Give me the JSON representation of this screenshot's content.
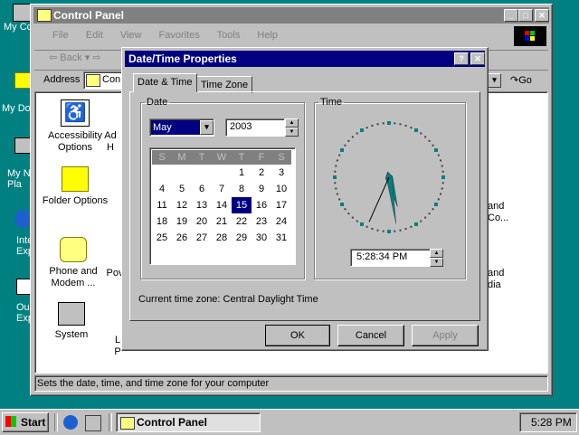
{
  "desktop": {
    "icons": [
      {
        "label": "My Co",
        "name": "desktop-icon-my-computer"
      },
      {
        "label": "My Do",
        "name": "desktop-icon-my-documents"
      },
      {
        "label": "My N\nPla",
        "name": "desktop-icon-network"
      },
      {
        "label": "Inte\nExp",
        "name": "desktop-icon-internet-explorer"
      },
      {
        "label": "Ou\nExp",
        "name": "desktop-icon-outlook-express"
      }
    ]
  },
  "control_panel": {
    "title": "Control Panel",
    "menu": [
      "File",
      "Edit",
      "View",
      "Favorites",
      "Tools",
      "Help"
    ],
    "back_label": "Back",
    "address_label": "Address",
    "address_value": "Con",
    "go_label": "Go",
    "status": "Sets the date, time, and time zone for your computer",
    "items": [
      {
        "label": "Accessibility\nOptions"
      },
      {
        "label": "Ad\nH"
      },
      {
        "label": "Folder Options"
      },
      {
        "label": "Phone and\nModem ..."
      },
      {
        "label": "Pov"
      },
      {
        "label": "System"
      },
      {
        "label": "L\nP"
      },
      {
        "label": "and\nCo..."
      },
      {
        "label": "and\ndia"
      }
    ]
  },
  "dialog": {
    "title": "Date/Time Properties",
    "help_label": "?",
    "close_label": "✕",
    "tabs": [
      "Date & Time",
      "Time Zone"
    ],
    "date_group": "Date",
    "time_group": "Time",
    "month": "May",
    "year": "2003",
    "weekdays": [
      "S",
      "M",
      "T",
      "W",
      "T",
      "F",
      "S"
    ],
    "weeks": [
      [
        "",
        "",
        "",
        "",
        "1",
        "2",
        "3"
      ],
      [
        "4",
        "5",
        "6",
        "7",
        "8",
        "9",
        "10"
      ],
      [
        "11",
        "12",
        "13",
        "14",
        "15",
        "16",
        "17"
      ],
      [
        "18",
        "19",
        "20",
        "21",
        "22",
        "23",
        "24"
      ],
      [
        "25",
        "26",
        "27",
        "28",
        "29",
        "30",
        "31"
      ]
    ],
    "selected_day": "15",
    "time_value": "5:28:34 PM",
    "time_zone_text": "Current time zone:  Central Daylight Time",
    "ok_label": "OK",
    "cancel_label": "Cancel",
    "apply_label": "Apply"
  },
  "taskbar": {
    "start_label": "Start",
    "task_label": "Control Panel",
    "clock": "5:28 PM"
  },
  "colors": {
    "desktop": "#008080",
    "title_active": "#000080",
    "title_inactive": "#808080",
    "face": "#c0c0c0"
  }
}
